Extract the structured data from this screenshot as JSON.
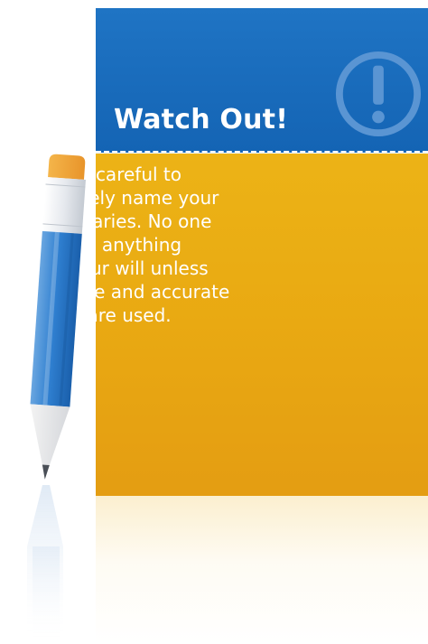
{
  "callout": {
    "title": "Watch Out!",
    "icon": "exclamation-circle-icon",
    "lines": [
      "Be very careful to",
      "accurately name your",
      "beneficiaries. No one",
      "receives anything",
      "from your will unless",
      "complete and accurate",
      "names are used."
    ]
  },
  "illustration": {
    "icon": "pencil-icon"
  },
  "colors": {
    "header_blue": "#1a6cbd",
    "body_gold": "#e9a912",
    "text_white": "#ffffff"
  }
}
